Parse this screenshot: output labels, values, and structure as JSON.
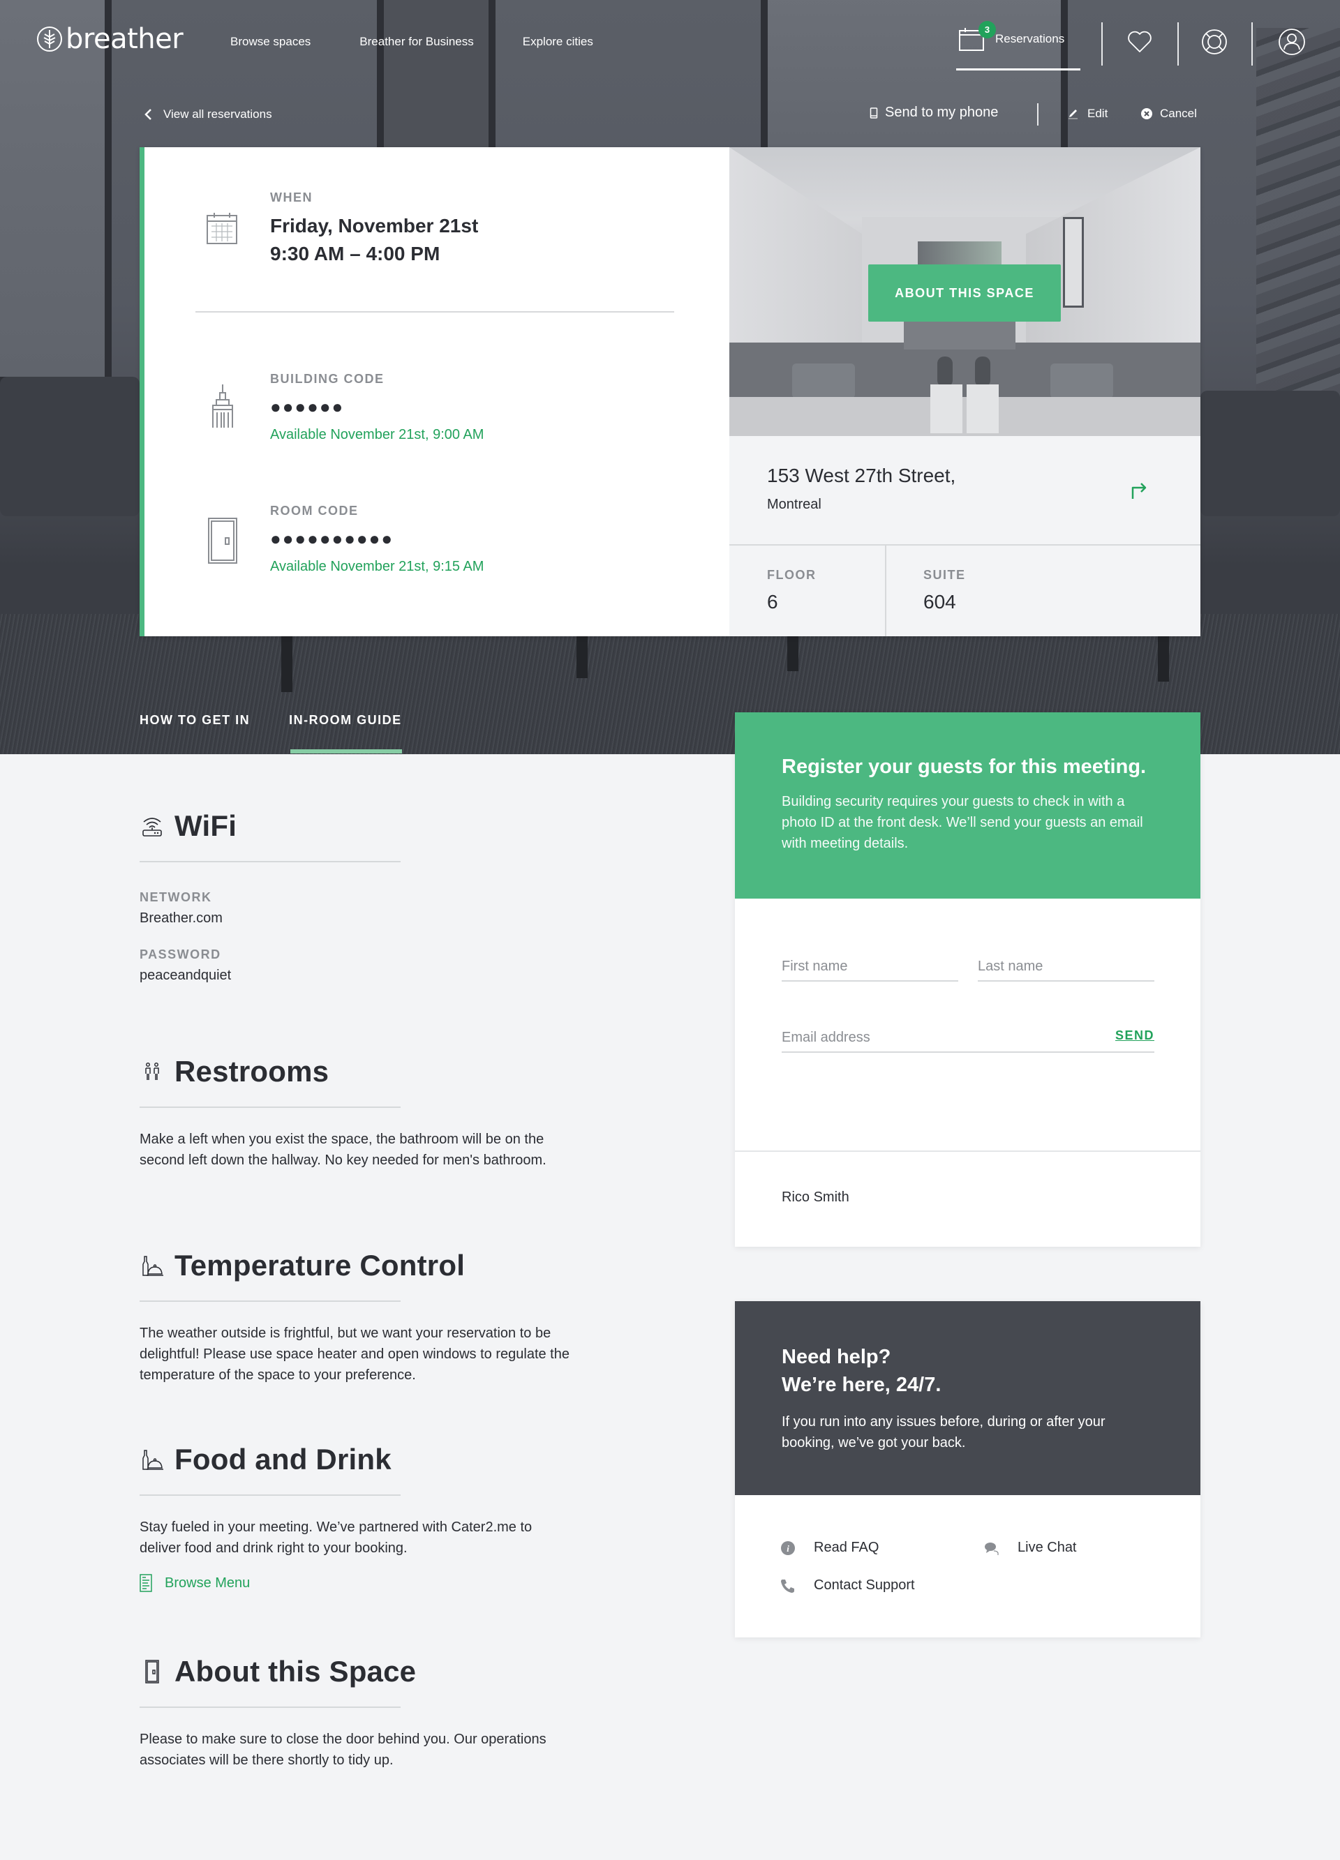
{
  "brand": {
    "name": "breather",
    "accent": "#4cb881",
    "accent_text": "#22a25b",
    "dark_panel": "#464950"
  },
  "nav": {
    "links": [
      "Browse spaces",
      "Breather for Business",
      "Explore cities"
    ],
    "reservations_label": "Reservations",
    "reservations_count": "3",
    "icons": [
      "heart-icon",
      "lifebuoy-icon",
      "user-icon"
    ]
  },
  "subnav": {
    "back_label": "View all reservations",
    "send_phone_label": "Send to my phone",
    "edit_label": "Edit",
    "cancel_label": "Cancel"
  },
  "reservation": {
    "when_label": "WHEN",
    "date": "Friday, November 21st",
    "time": "9:30 AM – 4:00 PM",
    "building_code_label": "BUILDING CODE",
    "building_code_masked": "●●●●●●",
    "building_code_available": "Available November 21st, 9:00 AM",
    "room_code_label": "ROOM CODE",
    "room_code_masked": "●●●●●●●●●●",
    "room_code_available": "Available November 21st, 9:15 AM",
    "about_button": "ABOUT THIS SPACE",
    "address_street": "153 West 27th Street,",
    "address_city": "Montreal",
    "floor_label": "FLOOR",
    "floor_value": "6",
    "suite_label": "SUITE",
    "suite_value": "604"
  },
  "tabs": [
    {
      "label": "HOW TO GET IN",
      "active": false
    },
    {
      "label": "IN-ROOM GUIDE",
      "active": true
    }
  ],
  "guide": {
    "wifi": {
      "title": "WiFi",
      "network_label": "NETWORK",
      "network_value": "Breather.com",
      "password_label": "PASSWORD",
      "password_value": "peaceandquiet"
    },
    "restrooms": {
      "title": "Restrooms",
      "body": "Make a left when you exist the space, the bathroom will be on the second left down the hallway. No key needed for men's bathroom."
    },
    "temperature": {
      "title": "Temperature Control",
      "body": "The weather outside is frightful, but we want your reservation to be delightful! Please use space heater and open windows to regulate the temperature of the space to your preference."
    },
    "food": {
      "title": "Food and Drink",
      "body": "Stay fueled in your meeting. We’ve partnered with Cater2.me to deliver food and drink right to your booking.",
      "menu_link": "Browse Menu"
    },
    "about": {
      "title": "About this Space",
      "body": "Please to make sure to close the door behind you. Our operations associates will be there shortly to tidy up."
    }
  },
  "register": {
    "title": "Register your guests for this meeting.",
    "description": "Building security requires your guests to check in with a photo ID at the front desk. We’ll send your guests an email with meeting details.",
    "first_name_placeholder": "First name",
    "last_name_placeholder": "Last name",
    "email_placeholder": "Email address",
    "send_label": "SEND",
    "guests": [
      "Rico Smith"
    ]
  },
  "help": {
    "title_line1": "Need help?",
    "title_line2": "We’re here, 24/7.",
    "description": "If you run into any issues before, during or after your booking, we’ve got your back.",
    "links": [
      {
        "label": "Read FAQ",
        "icon": "info-icon"
      },
      {
        "label": "Live Chat",
        "icon": "chat-icon"
      },
      {
        "label": "Contact Support",
        "icon": "phone-icon"
      }
    ]
  }
}
